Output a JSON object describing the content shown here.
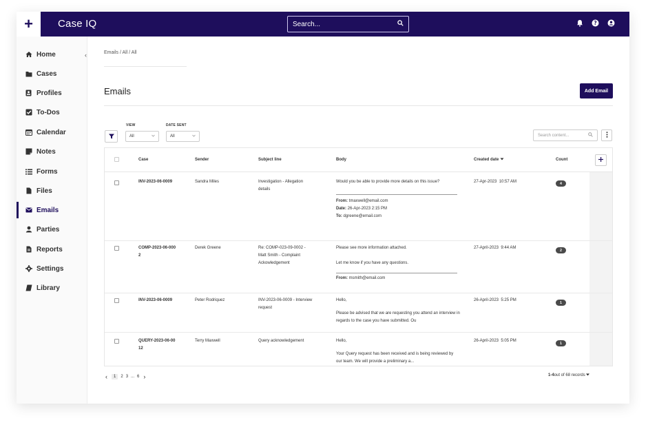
{
  "app": {
    "brand": "Case IQ",
    "plus_label": "+"
  },
  "search": {
    "placeholder": "Search..."
  },
  "sidebar": {
    "items": [
      {
        "label": "Home",
        "icon": "home-icon"
      },
      {
        "label": "Cases",
        "icon": "folder-icon"
      },
      {
        "label": "Profiles",
        "icon": "profile-icon"
      },
      {
        "label": "To-Dos",
        "icon": "checkbox-icon"
      },
      {
        "label": "Calendar",
        "icon": "calendar-icon"
      },
      {
        "label": "Notes",
        "icon": "note-icon"
      },
      {
        "label": "Forms",
        "icon": "list-icon"
      },
      {
        "label": "Files",
        "icon": "file-icon"
      },
      {
        "label": "Emails",
        "icon": "envelope-icon"
      },
      {
        "label": "Parties",
        "icon": "person-icon"
      },
      {
        "label": "Reports",
        "icon": "report-icon"
      },
      {
        "label": "Settings",
        "icon": "gear-icon"
      },
      {
        "label": "Library",
        "icon": "book-icon"
      }
    ],
    "active": "Emails",
    "collapse_glyph": "‹"
  },
  "breadcrumb": "Emails / All / All",
  "page_title": "Emails",
  "add_email_label": "Add Email",
  "filters": {
    "view_label": "VIEW",
    "view_value": "All",
    "date_label": "DATE SENT",
    "date_value": "All"
  },
  "content_search": {
    "placeholder": "Search content..."
  },
  "table": {
    "headers": {
      "case": "Case",
      "sender": "Sender",
      "subject": "Subject line",
      "body": "Body",
      "created": "Created date",
      "count": "Count"
    },
    "rows": [
      {
        "case": "INV-2023-06-0009",
        "sender": "Sandra Miles",
        "subject": "Investigation - Allegation details",
        "body_lines": [
          "Would you be able to provide more details on this issue?"
        ],
        "quote": [
          {
            "k": "From:",
            "v": " tmaxwell@email.com"
          },
          {
            "k": "Date:",
            "v": " 26-Apr-2023 2:15 PM"
          },
          {
            "k": "To:",
            "v": " dgreene@email.com"
          }
        ],
        "created": "27-Apr-2023  10:57 AM",
        "count": "4"
      },
      {
        "case": "COMP-2023-06-0002",
        "sender": "Derek Greene",
        "subject": "Re: COMP-023-09-0002 - Matt Smith - Complaint Ackowledgement",
        "body_lines": [
          "Please see more information attached.",
          "Let me know if you have any questions."
        ],
        "quote": [
          {
            "k": "From:",
            "v": " msmith@email.com"
          }
        ],
        "created": "27-April-2023  9:44 AM",
        "count": "2"
      },
      {
        "case": "INV-2023-06-0009",
        "sender": "Peter Rodriquez",
        "subject": "INV-2023-06-0009 - Interview request",
        "body_lines": [
          "Hello,",
          "Please be advised that we are requesting you attend an interview in regards to the case you have submitted. Ou"
        ],
        "quote": [],
        "created": "26-April-2023  5:25 PM",
        "count": "1"
      },
      {
        "case": "QUERY-2023-06-0012",
        "sender": "Terry Maxwell",
        "subject": "Query acknowledgement",
        "body_lines": [
          "Hello,",
          "Your Query request has been received and is being reviewed by our team. We will provide a preliminary a..."
        ],
        "quote": [],
        "created": "26-April-2023  5:05 PM",
        "count": "1"
      }
    ]
  },
  "pager": {
    "prev": "‹",
    "pages": [
      "1",
      "2",
      "3",
      "...",
      "6"
    ],
    "next": "›"
  },
  "records": {
    "range": "1-4",
    "rest": "out of 68 records"
  },
  "colors": {
    "brand": "#1e0e5c"
  }
}
